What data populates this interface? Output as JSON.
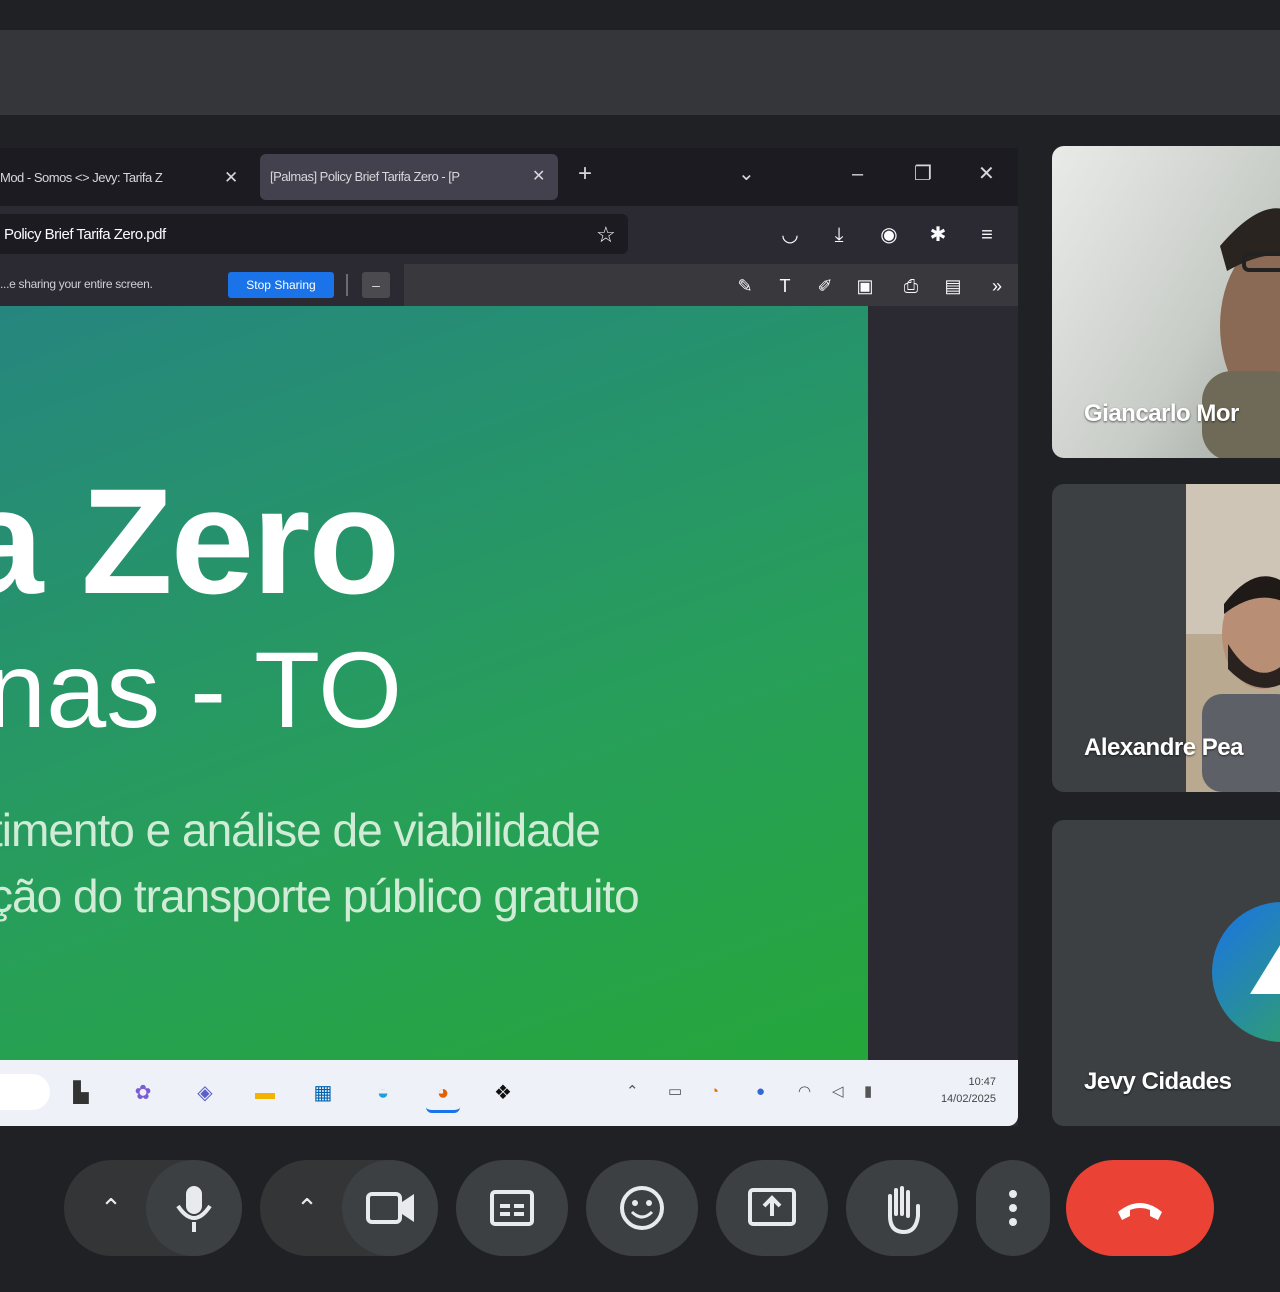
{
  "browser": {
    "tabs": [
      {
        "label": "Mod - Somos <> Jevy: Tarifa Z",
        "close": "✕"
      },
      {
        "label": "[Palmas] Policy Brief Tarifa Zero - [P",
        "close": "✕"
      }
    ],
    "new_tab": "+",
    "tab_list": "⌄",
    "window_controls": {
      "minimize": "–",
      "restore": "❐",
      "close": "✕"
    },
    "url": "Policy Brief Tarifa Zero.pdf",
    "sharing_banner": {
      "text": "...e sharing your entire screen.",
      "stop_button": "Stop Sharing",
      "minimize": "–"
    }
  },
  "slide": {
    "title_line1": "a Zero",
    "title_line2": "nas - TO",
    "subtitle_line1": "timento e análise de viabilidade",
    "subtitle_line2": "ção do transporte público gratuito"
  },
  "taskbar": {
    "time": "10:47",
    "date": "14/02/2025"
  },
  "participants": [
    {
      "name": "Giancarlo Mor"
    },
    {
      "name": "Alexandre Pea"
    },
    {
      "name": "Jevy Cidades"
    }
  ],
  "colors": {
    "end_call": "#ea4335",
    "stop_sharing": "#1a73e8",
    "slide_green": "#27a04c"
  }
}
